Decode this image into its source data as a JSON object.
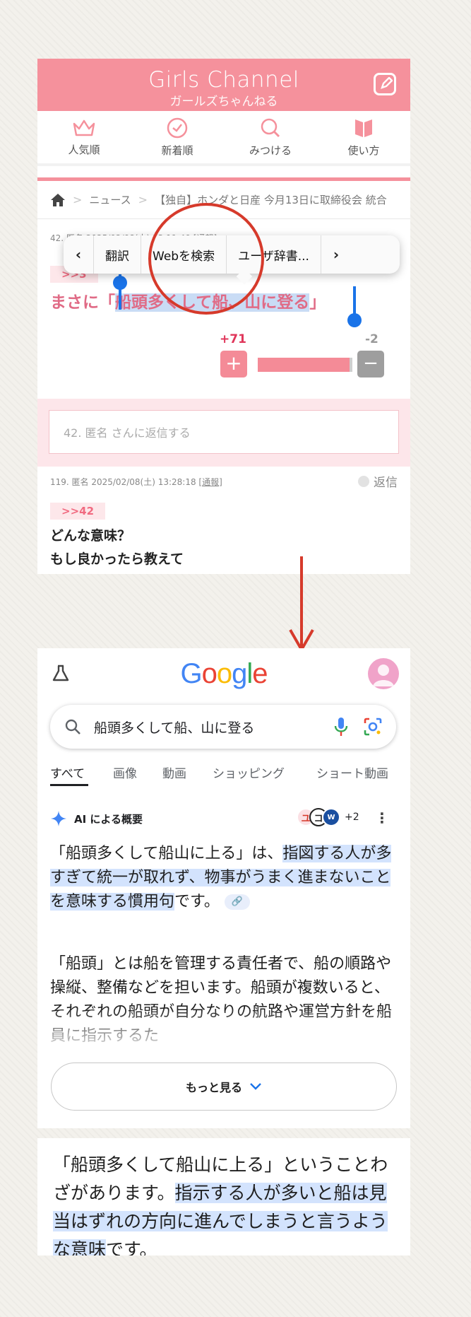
{
  "gc": {
    "logo": "Girls Channel",
    "logo_sub": "ガールズちゃんねる",
    "nav": [
      {
        "label": "人気順",
        "icon": "crown-icon"
      },
      {
        "label": "新着順",
        "icon": "clock-check-icon"
      },
      {
        "label": "みつける",
        "icon": "search-icon"
      },
      {
        "label": "使い方",
        "icon": "book-icon"
      }
    ],
    "breadcrumb": {
      "news": "ニュース",
      "article": "【独自】ホンダと日産 今月13日に取締役会 統合"
    },
    "comment1": {
      "meta": "42. 匿名 2025/02/08(土) 13:11:49 [通報]",
      "reply_to": ">>3",
      "text_prefix": "まさに「",
      "text_selected": "船頭多くして船、山に登る",
      "text_suffix": "」",
      "plus_count": "+71",
      "minus_count": "-2",
      "plus_sign": "+",
      "minus_sign": "−",
      "plus_ratio": 0.97
    },
    "reply_placeholder": "42. 匿名 さんに返信する",
    "comment2": {
      "meta": "119. 匿名 2025/02/08(土) 13:28:18",
      "report": "[通報]",
      "reply_label": "返信",
      "reply_to": ">>42",
      "line1": "どんな意味？",
      "line2": "もし良かったら教えて"
    },
    "context_menu": {
      "prev": "‹",
      "translate": "翻訳",
      "web_search": "Webを検索",
      "dictionary": "ユーザ辞書...",
      "next": "›"
    }
  },
  "google": {
    "logo_letters": [
      {
        "ch": "G",
        "color": "#4285F4"
      },
      {
        "ch": "o",
        "color": "#EA4335"
      },
      {
        "ch": "o",
        "color": "#FBBC05"
      },
      {
        "ch": "g",
        "color": "#4285F4"
      },
      {
        "ch": "l",
        "color": "#34A853"
      },
      {
        "ch": "e",
        "color": "#EA4335"
      }
    ],
    "query": "船頭多くして船、山に登る",
    "tabs": [
      "すべて",
      "画像",
      "動画",
      "ショッピング",
      "ショート動画"
    ],
    "ai_label": "AI による概要",
    "ai_sources_more": "+2",
    "source_icons": [
      "ユ",
      "コ",
      "W"
    ],
    "para1_a": "「船頭多くして船山に上る」は、",
    "para1_hl": "指図する人が多すぎて統一が取れず、物事がうまく進まないことを意味する慣用句",
    "para1_b": "です。",
    "para2": "「船頭」とは船を管理する責任者で、船の順路や操縦、整備などを担います。船頭が複数いると、それぞれの船頭が自分なりの航路や運営方針を船員に指示するた",
    "more_button": "もっと見る"
  },
  "note": {
    "a": "「船頭多くして船山に上る」ということわざがあります。",
    "hl": "指示する人が多いと船は見当はずれの方向に進んでしまうと言うような意味",
    "b": "です。"
  },
  "colors": {
    "brand_pink": "#f5919c",
    "accent_pink": "#f16a80",
    "selection_blue": "#1a73e8",
    "annotation_red": "#d63a2b"
  }
}
